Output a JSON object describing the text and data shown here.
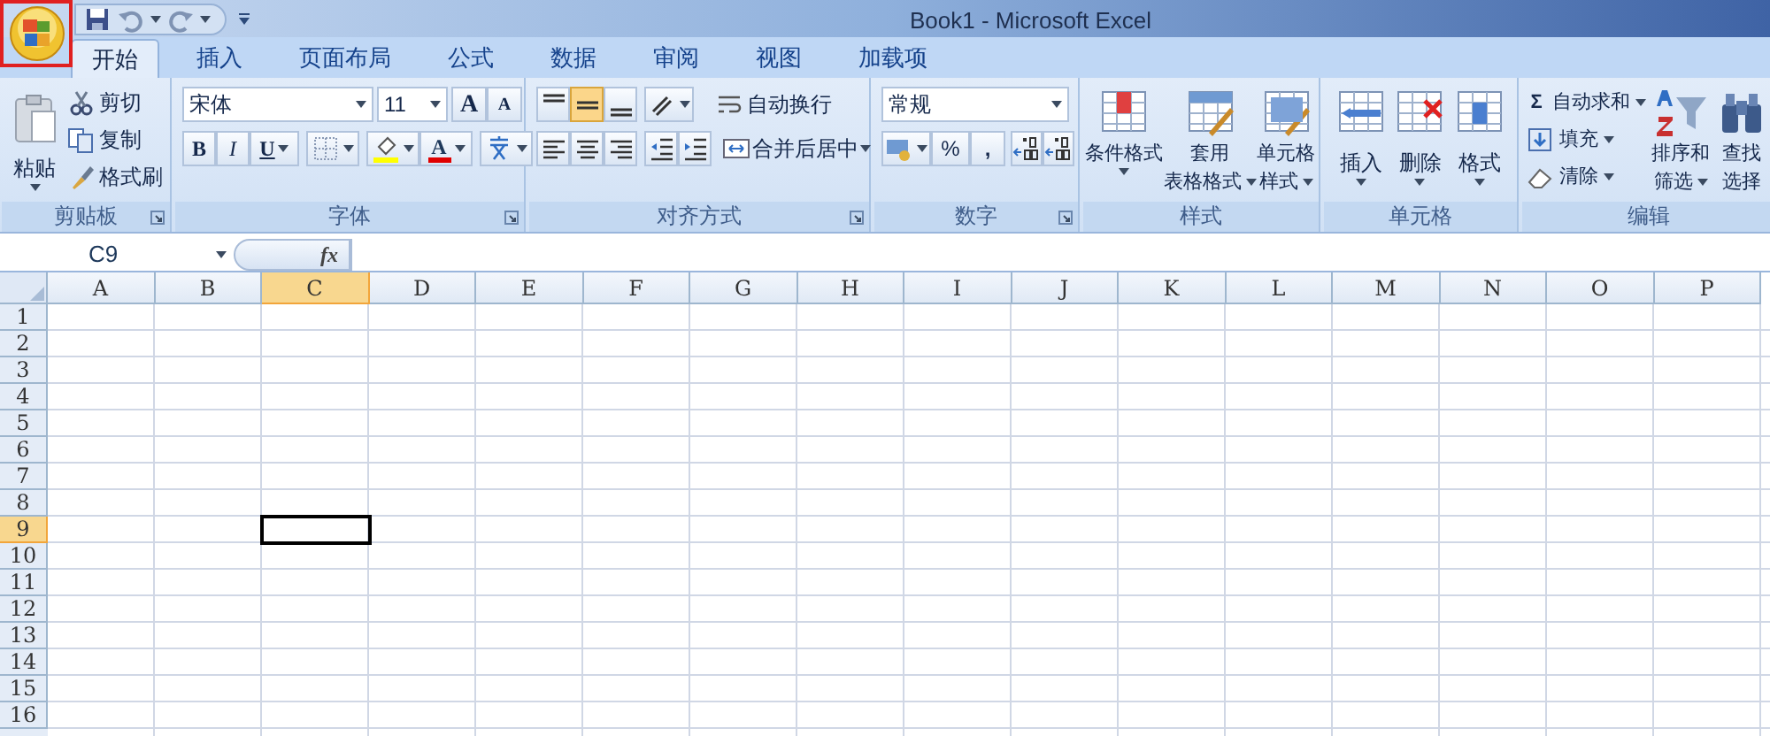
{
  "window": {
    "title": "Book1 - Microsoft Excel"
  },
  "tabs": [
    {
      "label": "开始",
      "selected": true
    },
    {
      "label": "插入",
      "selected": false
    },
    {
      "label": "页面布局",
      "selected": false
    },
    {
      "label": "公式",
      "selected": false
    },
    {
      "label": "数据",
      "selected": false
    },
    {
      "label": "审阅",
      "selected": false
    },
    {
      "label": "视图",
      "selected": false
    },
    {
      "label": "加载项",
      "selected": false
    }
  ],
  "clipboard": {
    "label": "剪贴板",
    "paste": "粘贴",
    "items": [
      "剪切",
      "复制",
      "格式刷"
    ]
  },
  "font": {
    "label": "字体",
    "font_name": "宋体",
    "font_size": "11",
    "grow": "A",
    "shrink": "A",
    "bold": "B",
    "italic": "I",
    "underline": "U",
    "font_color": "A"
  },
  "alignment": {
    "label": "对齐方式",
    "wrap_text": "自动换行",
    "merge": "合并后居中",
    "vertical": [
      {
        "selected": false
      },
      {
        "selected": true
      },
      {
        "selected": false
      }
    ]
  },
  "number": {
    "label": "数字",
    "format": "常规",
    "percent": "%",
    "comma": ","
  },
  "styles": {
    "label": "样式",
    "buttons": [
      {
        "lines": [
          "条件格式"
        ]
      },
      {
        "lines": [
          "套用",
          "表格格式"
        ]
      },
      {
        "lines": [
          "单元格",
          "样式"
        ]
      }
    ]
  },
  "cells": {
    "label": "单元格",
    "buttons": [
      "插入",
      "删除",
      "格式"
    ]
  },
  "editing": {
    "label": "编辑",
    "sigma": "Σ",
    "items": [
      "自动求和",
      "填充",
      "清除"
    ],
    "buttons": [
      {
        "lines": [
          "排序和",
          "筛选"
        ]
      },
      {
        "lines": [
          "查找",
          "选择"
        ]
      }
    ]
  },
  "formula_bar": {
    "name_box": "C9",
    "fx": "fx"
  },
  "sheet": {
    "columns": [
      {
        "label": "A",
        "selected": false
      },
      {
        "label": "B",
        "selected": false
      },
      {
        "label": "C",
        "selected": true
      },
      {
        "label": "D",
        "selected": false
      },
      {
        "label": "E",
        "selected": false
      },
      {
        "label": "F",
        "selected": false
      },
      {
        "label": "G",
        "selected": false
      },
      {
        "label": "H",
        "selected": false
      },
      {
        "label": "I",
        "selected": false
      },
      {
        "label": "J",
        "selected": false
      },
      {
        "label": "K",
        "selected": false
      },
      {
        "label": "L",
        "selected": false
      },
      {
        "label": "M",
        "selected": false
      },
      {
        "label": "N",
        "selected": false
      },
      {
        "label": "O",
        "selected": false
      },
      {
        "label": "P",
        "selected": false
      }
    ],
    "rows": [
      {
        "label": "1",
        "selected": false
      },
      {
        "label": "2",
        "selected": false
      },
      {
        "label": "3",
        "selected": false
      },
      {
        "label": "4",
        "selected": false
      },
      {
        "label": "5",
        "selected": false
      },
      {
        "label": "6",
        "selected": false
      },
      {
        "label": "7",
        "selected": false
      },
      {
        "label": "8",
        "selected": false
      },
      {
        "label": "9",
        "selected": true
      },
      {
        "label": "10",
        "selected": false
      },
      {
        "label": "11",
        "selected": false
      },
      {
        "label": "12",
        "selected": false
      },
      {
        "label": "13",
        "selected": false
      },
      {
        "label": "14",
        "selected": false
      },
      {
        "label": "15",
        "selected": false
      },
      {
        "label": "16",
        "selected": false
      }
    ]
  }
}
